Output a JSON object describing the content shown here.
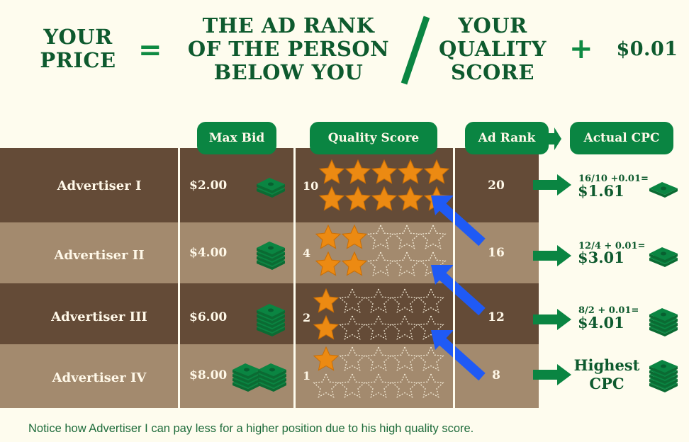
{
  "formula": {
    "left": [
      "YOUR",
      "PRICE"
    ],
    "equals": "=",
    "numerator": [
      "THE AD RANK",
      "OF THE PERSON",
      "BELOW YOU"
    ],
    "divide": "/",
    "denominator": [
      "YOUR",
      "QUALITY",
      "SCORE"
    ],
    "plus": "+",
    "increment": "$0.01"
  },
  "headers": {
    "max_bid": "Max Bid",
    "quality_score": "Quality Score",
    "ad_rank": "Ad Rank",
    "actual_cpc": "Actual CPC"
  },
  "advertisers": [
    {
      "name": "Advertiser I",
      "max_bid": "$2.00",
      "money_icon": "cash-stack-2",
      "quality_score": "10",
      "qs_value": 10,
      "ad_rank": "20",
      "cpc_formula": "16/10 +0.01=",
      "cpc": "$1.61",
      "cpc_icon": "cash-stack-1"
    },
    {
      "name": "Advertiser II",
      "max_bid": "$4.00",
      "money_icon": "cash-stack-4",
      "quality_score": "4",
      "qs_value": 4,
      "ad_rank": "16",
      "cpc_formula": "12/4 + 0.01=",
      "cpc": "$3.01",
      "cpc_icon": "cash-stack-2"
    },
    {
      "name": "Advertiser III",
      "max_bid": "$6.00",
      "money_icon": "cash-stack-6",
      "quality_score": "2",
      "qs_value": 2,
      "ad_rank": "12",
      "cpc_formula": "8/2 + 0.01=",
      "cpc": "$4.01",
      "cpc_icon": "cash-stack-4"
    },
    {
      "name": "Advertiser IV",
      "max_bid": "$8.00",
      "money_icon": "cash-stack-double",
      "quality_score": "1",
      "qs_value": 1,
      "ad_rank": "8",
      "cpc_label": [
        "Highest",
        "CPC"
      ],
      "cpc_icon": "cash-stack-6"
    }
  ],
  "stars_max": 10,
  "colors": {
    "background": "#fefcee",
    "brand_green": "#0a8542",
    "text_green": "#0e5a2e",
    "row_dark": "#644b37",
    "row_light": "#a38a6e",
    "star_orange": "#ec8a12",
    "arrow_blue": "#1f5af5"
  },
  "footnote": "Notice how Advertiser I can pay less for a higher position due to his high quality score."
}
